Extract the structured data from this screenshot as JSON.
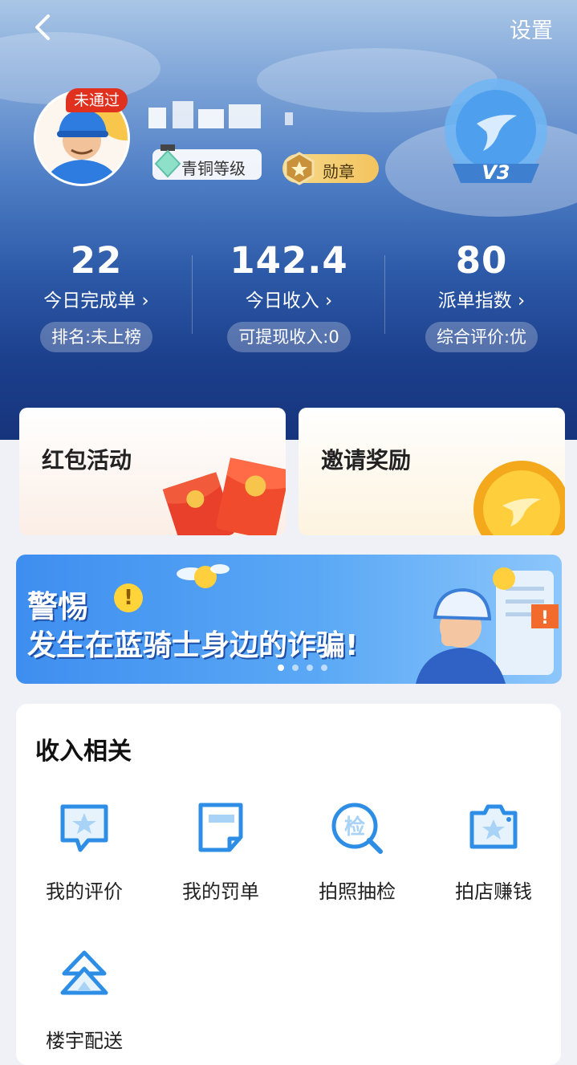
{
  "header": {
    "settings_label": "设置",
    "status_badge": "未通过",
    "level_label": "青铜等级",
    "medal_label": "勋章",
    "vip_level": "V3"
  },
  "stats": [
    {
      "value": "22",
      "label": "今日完成单",
      "pill": "排名:未上榜"
    },
    {
      "value": "142.4",
      "label": "今日收入",
      "pill": "可提现收入:0"
    },
    {
      "value": "80",
      "label": "派单指数",
      "pill": "综合评价:优"
    }
  ],
  "promos": {
    "red_packet": "红包活动",
    "invite": "邀请奖励"
  },
  "banner": {
    "line1": "警惕",
    "line2": "发生在蓝骑士身边的诈骗!",
    "slide_count": 4,
    "active_slide": 1
  },
  "income_section": {
    "title": "收入相关",
    "items": [
      {
        "label": "我的评价",
        "icon": "star-chat-icon"
      },
      {
        "label": "我的罚单",
        "icon": "ticket-icon"
      },
      {
        "label": "拍照抽检",
        "icon": "check-icon",
        "icon_text": "检"
      },
      {
        "label": "拍店赚钱",
        "icon": "camera-icon"
      },
      {
        "label": "楼宇配送",
        "icon": "building-icon"
      }
    ]
  },
  "colors": {
    "accent": "#2e8ee6",
    "header_dark": "#16347c",
    "fail_badge": "#e0301e"
  }
}
